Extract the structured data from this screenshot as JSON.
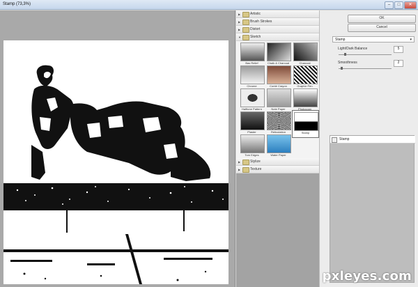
{
  "window": {
    "title": "Stamp (73,3%)"
  },
  "title_controls": [
    "–",
    "□",
    "✕"
  ],
  "filter_categories": {
    "before": [
      "Artistic",
      "Brush Strokes",
      "Distort"
    ],
    "open": "Sketch",
    "after": [
      "Stylize",
      "Texture"
    ]
  },
  "sketch_filters": [
    "Bas Relief",
    "Chalk & Charcoal",
    "Charcoal",
    "Chrome",
    "Conté Crayon",
    "Graphic Pen",
    "Halftone Pattern",
    "Note Paper",
    "Photocopy",
    "Plaster",
    "Reticulation",
    "Stamp",
    "Torn Edges",
    "Water Paper"
  ],
  "selected_filter": "Stamp",
  "buttons": {
    "ok": "OK",
    "cancel": "Cancel"
  },
  "filter_dropdown": {
    "value": "Stamp"
  },
  "params": {
    "balance_label": "Light/Dark Balance",
    "balance_value": "5",
    "balance_fraction": 0.1,
    "smooth_label": "Smoothness",
    "smooth_value": "2",
    "smooth_fraction": 0.04
  },
  "effect_layers": [
    {
      "name": "Stamp"
    }
  ],
  "watermark": "pxleyes.com",
  "colors": {
    "accent": "#6d6d6d",
    "panel": "#f3f3f3",
    "canvas_bg": "#a9a9a9"
  }
}
